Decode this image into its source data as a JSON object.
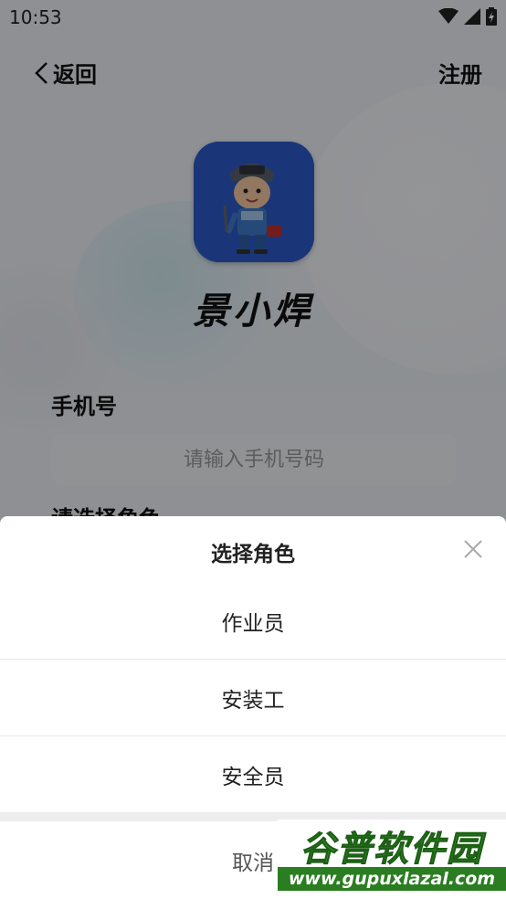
{
  "status_bar": {
    "time": "10:53"
  },
  "nav": {
    "back_label": "返回",
    "register_label": "注册"
  },
  "app": {
    "name": "景小焊"
  },
  "form": {
    "phone_label": "手机号",
    "phone_placeholder": "请输入手机号码",
    "role_label": "请选择角色"
  },
  "sheet": {
    "title": "选择角色",
    "options": [
      "作业员",
      "安装工",
      "安全员"
    ],
    "cancel_label": "取消"
  },
  "watermark": {
    "title": "谷普软件园",
    "url": "www.gupuxlazal.com"
  },
  "colors": {
    "logo_bg": "#2c5bc9",
    "watermark_green": "#2a7d20"
  }
}
